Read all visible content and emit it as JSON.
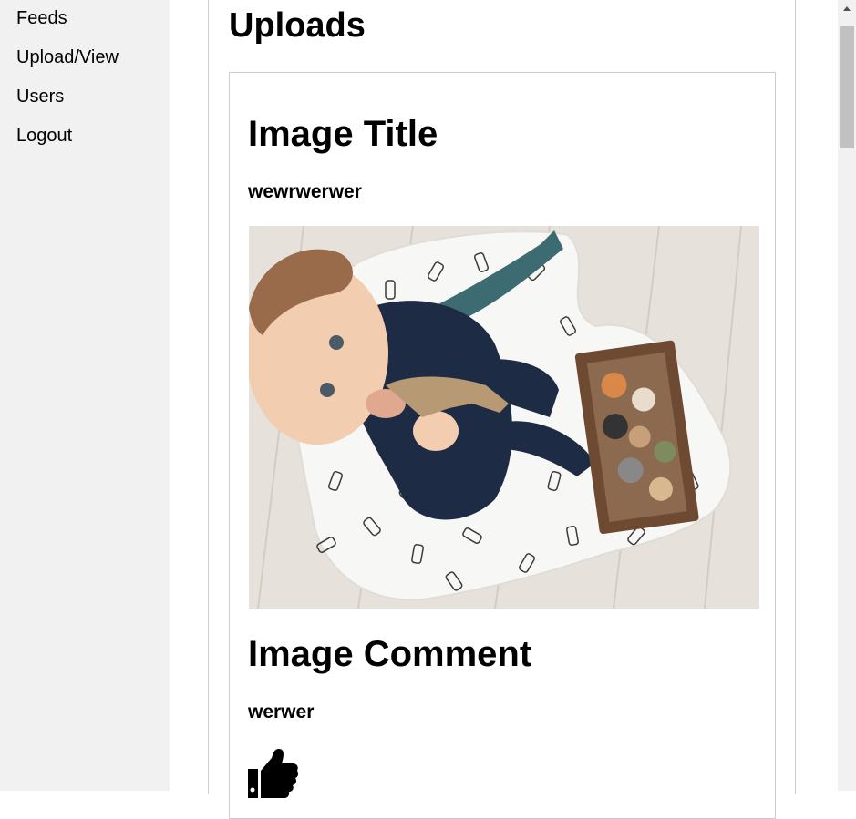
{
  "sidebar": {
    "items": [
      {
        "label": "Feeds"
      },
      {
        "label": "Upload/View"
      },
      {
        "label": "Users"
      },
      {
        "label": "Logout"
      }
    ]
  },
  "main": {
    "title": "Uploads",
    "card": {
      "title_heading": "Image Title",
      "title_value": "wewrwerwer",
      "comment_heading": "Image Comment",
      "comment_value": "werwer",
      "like_icon": "thumbs-up-icon"
    }
  },
  "colors": {
    "sidebar_bg": "#f1f1f1",
    "border": "#cccccc",
    "scroll_thumb": "#c1c1c1"
  }
}
